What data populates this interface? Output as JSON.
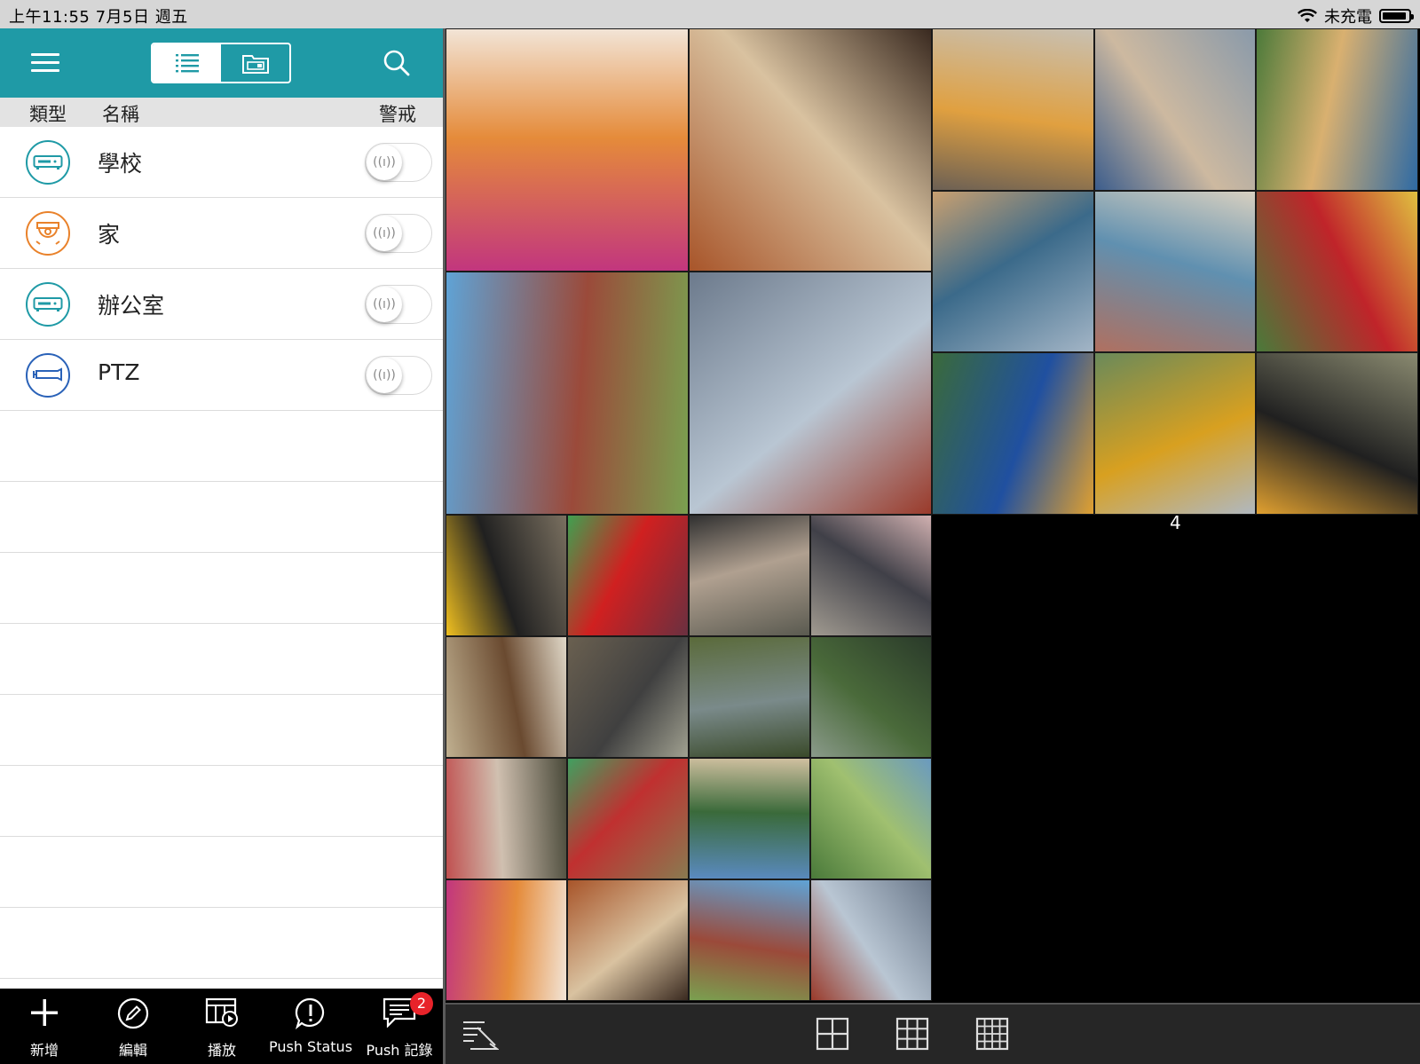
{
  "status_bar": {
    "time_date": "上午11:55   7月5日 週五",
    "charging_text": "未充電"
  },
  "left_panel": {
    "column_headers": {
      "type": "類型",
      "name": "名稱",
      "alarm": "警戒"
    },
    "devices": [
      {
        "name": "學校",
        "icon": "nvr-icon",
        "color": "#1f9aa6"
      },
      {
        "name": "家",
        "icon": "fisheye-camera-icon",
        "color": "#e9822b"
      },
      {
        "name": "辦公室",
        "icon": "nvr-icon",
        "color": "#1f9aa6"
      },
      {
        "name": "PTZ",
        "icon": "ptz-camera-icon",
        "color": "#2a62b8"
      }
    ]
  },
  "tab_bar": {
    "items": [
      {
        "label": "新增",
        "icon": "plus-icon"
      },
      {
        "label": "編輯",
        "icon": "pencil-icon"
      },
      {
        "label": "播放",
        "icon": "playback-icon"
      },
      {
        "label": "Push Status",
        "icon": "alert-icon"
      },
      {
        "label": "Push 記錄",
        "icon": "message-log-icon",
        "badge": "2"
      }
    ]
  },
  "video_wall": {
    "empty_channel_number": "4"
  },
  "colors": {
    "teal": "#1f9aa6",
    "orange": "#e9822b",
    "blue": "#2a62b8",
    "badge_red": "#e8232a"
  }
}
